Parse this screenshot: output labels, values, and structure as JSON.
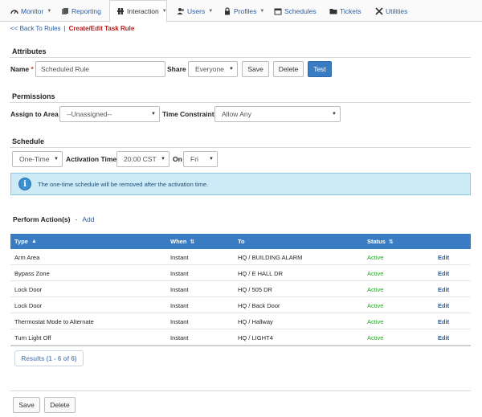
{
  "nav": {
    "items": [
      {
        "label": "Monitor",
        "icon": "dashboard-icon",
        "caret": true
      },
      {
        "label": "Reporting",
        "icon": "report-icon",
        "caret": false
      },
      {
        "label": "Interaction",
        "icon": "interaction-icon",
        "caret": true,
        "active": true
      },
      {
        "label": "Users",
        "icon": "users-icon",
        "caret": true
      },
      {
        "label": "Profiles",
        "icon": "lock-icon",
        "caret": true
      },
      {
        "label": "Schedules",
        "icon": "calendar-icon",
        "caret": false
      },
      {
        "label": "Tickets",
        "icon": "folder-icon",
        "caret": false
      },
      {
        "label": "Utilities",
        "icon": "tools-icon",
        "caret": false
      }
    ]
  },
  "breadcrumb": {
    "back": "<< Back To Rules",
    "separator": "|",
    "current": "Create/Edit Task Rule"
  },
  "attributes": {
    "title": "Attributes",
    "name_label": "Name",
    "name_required": "*",
    "name_value": "Scheduled Rule",
    "share_label": "Share",
    "share_value": "Everyone",
    "save": "Save",
    "delete": "Delete",
    "test": "Test"
  },
  "permissions": {
    "title": "Permissions",
    "area_label": "Assign to Area",
    "area_value": "--Unassigned--",
    "time_label": "Time Constraint",
    "time_value": "Allow Any"
  },
  "schedule": {
    "title": "Schedule",
    "type_value": "One-Time",
    "activation_label": "Activation Time",
    "activation_value": "20:00 CST",
    "on_label": "On",
    "day_value": "Fri",
    "info_text": "The one-time schedule will be removed after the activation time."
  },
  "actions": {
    "title": "Perform Action(s)",
    "dash": "-",
    "add": "Add",
    "columns": {
      "type": "Type",
      "when": "When",
      "to": "To",
      "status": "Status"
    },
    "rows": [
      {
        "type": "Arm Area",
        "when": "Instant",
        "to": "HQ / BUILDING ALARM",
        "status": "Active",
        "edit": "Edit"
      },
      {
        "type": "Bypass Zone",
        "when": "Instant",
        "to": "HQ / E HALL DR",
        "status": "Active",
        "edit": "Edit"
      },
      {
        "type": "Lock Door",
        "when": "Instant",
        "to": "HQ / 505 DR",
        "status": "Active",
        "edit": "Edit"
      },
      {
        "type": "Lock Door",
        "when": "Instant",
        "to": "HQ / Back Door",
        "status": "Active",
        "edit": "Edit"
      },
      {
        "type": "Thermostat Mode to Alternate",
        "when": "Instant",
        "to": "HQ / Hallway",
        "status": "Active",
        "edit": "Edit"
      },
      {
        "type": "Turn Light Off",
        "when": "Instant",
        "to": "HQ / LIGHT4",
        "status": "Active",
        "edit": "Edit"
      }
    ],
    "results": "Results (1 - 6 of 6)"
  },
  "footer": {
    "save": "Save",
    "delete": "Delete"
  },
  "colors": {
    "accent": "#3a7cc4",
    "link": "#2a5d9e",
    "status_active": "#2f9e2f",
    "breadcrumb_current": "#b11e1e",
    "info_bg": "#cdeaf7"
  }
}
